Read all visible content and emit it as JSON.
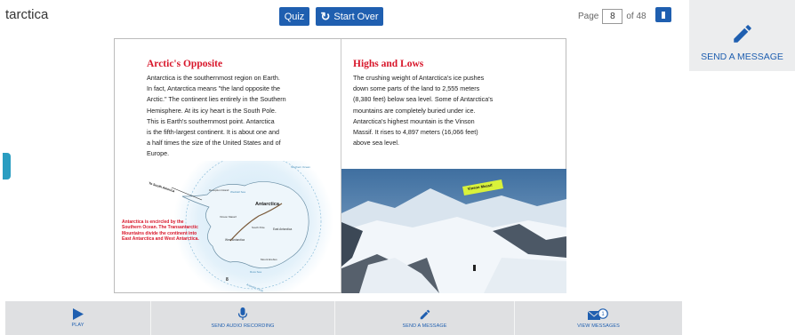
{
  "header": {
    "title": "tarctica",
    "quiz_label": "Quiz",
    "start_over_label": "Start Over",
    "page_prefix": "Page",
    "page_current": "8",
    "page_total": "of 48"
  },
  "side_panel": {
    "label": "SEND A MESSAGE",
    "icon": "pencil-icon"
  },
  "book": {
    "left": {
      "heading": "Arctic's Opposite",
      "text": [
        "Antarctica is the southernmost region on Earth.",
        "In fact, Antarctica means \"the land opposite the",
        "Arctic.\" The continent lies entirely in the Southern",
        "Hemisphere. At its icy heart is the South Pole.",
        "This is Earth's southernmost point. Antarctica",
        "is the fifth-largest continent. It is about one and",
        "a half times the size of the United States and of",
        "Europe."
      ],
      "map_caption": "Antarctica is encircled by the Southern Ocean. The Transantarctic Mountains divide the continent into East Antarctica and West Antarctica.",
      "map_labels": {
        "continent": "Antarctica",
        "south_america": "To South America",
        "southern_ocean": "Southern Ocean",
        "weddell_sea": "Weddell Sea",
        "ross_sea": "Ross Sea",
        "east": "East Antarctica",
        "west": "West Antarctica",
        "south_pole": "South Pole",
        "vinson": "Vinson Massif",
        "mountains": "Transantarctic Mountains",
        "erebus": "Mount Erebus",
        "peninsula": "Antarctic Peninsula",
        "deception": "Deception Island",
        "circle": "Antarctic Circle"
      },
      "page_number": "8"
    },
    "right": {
      "heading": "Highs and Lows",
      "text": [
        "The crushing weight of Antarctica's ice pushes",
        "down some parts of the land to 2,555 meters",
        "(8,380 feet) below sea level. Some of Antarctica's",
        "mountains are completely buried under ice.",
        "Antarctica's highest mountain is the Vinson",
        "Massif. It rises to 4,897 meters (16,066 feet)",
        "above sea level."
      ],
      "photo_label": "Vinson Massif"
    }
  },
  "toolbar": {
    "items": [
      {
        "label": "PLAY",
        "icon": "play-icon"
      },
      {
        "label": "SEND AUDIO RECORDING",
        "icon": "microphone-icon"
      },
      {
        "label": "SEND A MESSAGE",
        "icon": "pencil-icon"
      },
      {
        "label": "VIEW MESSAGES",
        "icon": "envelope-icon",
        "badge": "1"
      }
    ]
  },
  "colors": {
    "accent": "#1f5fb0",
    "heading_red": "#d8162a",
    "toolbar_bg": "#dfe0e2",
    "panel_bg": "#ecedee"
  }
}
